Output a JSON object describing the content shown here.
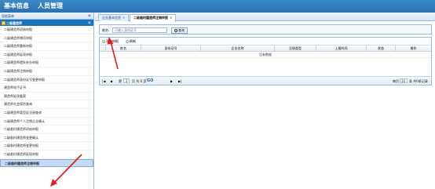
{
  "topnav": {
    "items": [
      "基本信息",
      "人员管理"
    ]
  },
  "sidebar": {
    "header": "导航菜单",
    "group": "二级建造师",
    "items": [
      "二级建造师初始申报",
      "二级建造师增项申报",
      "二级建造师重新申报",
      "二级建造师延续申报",
      "二级建造师遗失补办申报",
      "二级建造师注销申报",
      "二级建造师身份证号变更申报",
      "建造师电子证书",
      "建造师延续备案",
      "建造师社会保险查询",
      "二级建造师类型证注册查询",
      "二级建造师个人注销企业确认",
      "二级临时建造师初始申报",
      "二级临时建造师变更确认",
      "二级临时建造师变更申报",
      "二级临时建造师延续申报",
      "二级临时建造师注销申报"
    ],
    "active_index": 16
  },
  "tabs": [
    {
      "label": "企业基本信息",
      "close": "×"
    },
    {
      "label": "二级临时建造师注销申报",
      "close": "×"
    }
  ],
  "search": {
    "label": "姓名:",
    "placeholder": "可输入身份证号",
    "button": "查询"
  },
  "toolbar": {
    "add": "添加申报",
    "refresh": "刷新"
  },
  "table": {
    "columns": [
      "姓名",
      "身份证号",
      "企业名称",
      "注册类型",
      "上报时间",
      "状态",
      "操作"
    ],
    "empty_text": "没有数据"
  },
  "pager": {
    "page_prefix": "第",
    "page_value": "1",
    "of_pages": "页 共 0 页",
    "go": "GO",
    "per_page_prefix": "每页",
    "per_page_value": "30",
    "total_text": "条 共0条记录"
  },
  "colors": {
    "topbar": "#2a6fb0",
    "accent": "#1e73b8",
    "arrow": "#e02020"
  }
}
